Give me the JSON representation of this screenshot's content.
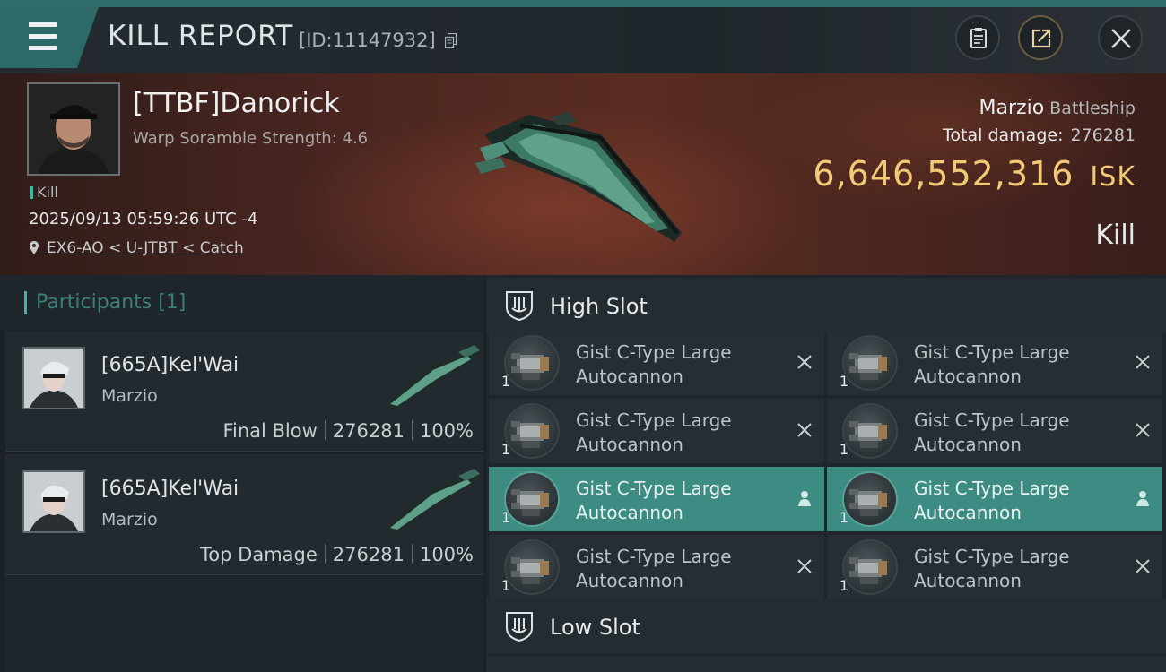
{
  "header": {
    "title": "KILL REPORT",
    "report_id": "[ID:11147932]"
  },
  "victim": {
    "name": "[TTBF]Danorick",
    "warp_scramble": "Warp Soramble Strength: 4.6",
    "kill_tag": "Kill",
    "datetime": "2025/09/13 05:59:26 UTC -4",
    "location": "EX6-AO < U-JTBT < Catch",
    "ship_name": "Marzio",
    "ship_class": "Battleship",
    "total_damage_label": "Total damage:",
    "total_damage": "276281",
    "isk_value": "6,646,552,316",
    "isk_unit": "ISK",
    "result": "Kill"
  },
  "participants": {
    "label": "Participants [1]",
    "cards": [
      {
        "name": "[665A]Kel'Wai",
        "ship": "Marzio",
        "role": "Final Blow",
        "damage": "276281",
        "percent": "100%"
      },
      {
        "name": "[665A]Kel'Wai",
        "ship": "Marzio",
        "role": "Top Damage",
        "damage": "276281",
        "percent": "100%"
      }
    ]
  },
  "slots": {
    "high_label": "High Slot",
    "low_label": "Low Slot",
    "high_modules": [
      {
        "line1": "Gist C-Type Large",
        "line2": "Autocannon",
        "qty": "1",
        "state": "destroyed"
      },
      {
        "line1": "Gist C-Type Large",
        "line2": "Autocannon",
        "qty": "1",
        "state": "destroyed"
      },
      {
        "line1": "Gist C-Type Large",
        "line2": "Autocannon",
        "qty": "1",
        "state": "destroyed"
      },
      {
        "line1": "Gist C-Type Large",
        "line2": "Autocannon",
        "qty": "1",
        "state": "destroyed"
      },
      {
        "line1": "Gist C-Type Large",
        "line2": "Autocannon",
        "qty": "1",
        "state": "dropped"
      },
      {
        "line1": "Gist C-Type Large",
        "line2": "Autocannon",
        "qty": "1",
        "state": "dropped"
      },
      {
        "line1": "Gist C-Type Large",
        "line2": "Autocannon",
        "qty": "1",
        "state": "destroyed"
      },
      {
        "line1": "Gist C-Type Large",
        "line2": "Autocannon",
        "qty": "1",
        "state": "destroyed"
      }
    ]
  },
  "icons": {
    "menu": "hamburger-menu-icon",
    "copy": "copy-icon",
    "clipboard": "clipboard-icon",
    "share": "share-icon",
    "close": "close-icon",
    "location": "location-pin-icon",
    "slot": "slot-shield-icon",
    "destroyed": "x-icon",
    "dropped": "person-icon"
  },
  "colors": {
    "accent_teal": "#3fb5a8",
    "highlight_row": "#3d8c84",
    "isk_gold": "#f1c977",
    "banner_red": "#5a2c22"
  }
}
